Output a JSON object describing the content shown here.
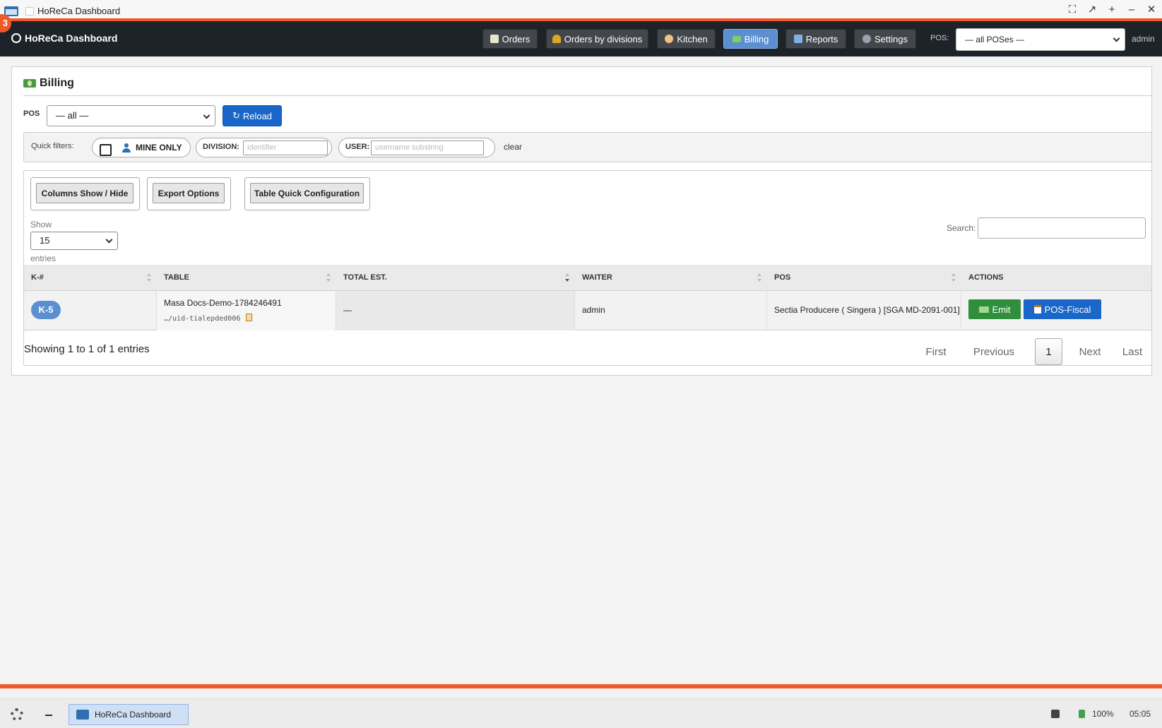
{
  "window": {
    "title": "HoReCa Dashboard",
    "notification_count": "3"
  },
  "navbar": {
    "brand": "HoReCa Dashboard",
    "items": [
      {
        "label": "Orders",
        "icon": "memo-icon",
        "active": false
      },
      {
        "label": "Orders by divisions",
        "icon": "bell-icon",
        "active": false
      },
      {
        "label": "Kitchen",
        "icon": "chef-icon",
        "active": false
      },
      {
        "label": "Billing",
        "icon": "money-icon",
        "active": true
      },
      {
        "label": "Reports",
        "icon": "chart-icon",
        "active": false
      },
      {
        "label": "Settings",
        "icon": "gear-icon",
        "active": false
      }
    ],
    "pos_label": "POS:",
    "pos_selected": "— all POSes —",
    "user": "admin"
  },
  "billing": {
    "title": "Billing",
    "pos_label": "POS",
    "pos_selected": "— all —",
    "reload_label": "Reload",
    "quick_filters": {
      "label": "Quick filters:",
      "mine_only_label": "MINE ONLY",
      "mine_only_checked": false,
      "division_label": "DIVISION:",
      "division_placeholder": "identifier",
      "user_label": "USER:",
      "user_placeholder": "username substring",
      "clear_label": "clear"
    },
    "toolbar": {
      "columns_label": "Columns Show / Hide",
      "export_label": "Export Options",
      "config_label": "Table Quick Configuration"
    },
    "show_label": "Show",
    "page_size": "15",
    "entries_label": "entries",
    "search_label": "Search:",
    "columns": [
      "K-#",
      "TABLE",
      "TOTAL EST.",
      "WAITER",
      "POS",
      "ACTIONS"
    ],
    "rows": [
      {
        "k": "K-5",
        "table_name": "Masa Docs-Demo-1784246491",
        "table_uid": "…/uid-tialepded006",
        "total_est": "—",
        "waiter": "admin",
        "pos": "Sectia Producere ( Singera ) [SGA MD-2091-001]",
        "emit_label": "Emit",
        "fiscal_label": "POS-Fiscal"
      }
    ],
    "info": "Showing 1 to 1 of 1 entries",
    "pagination": {
      "first": "First",
      "previous": "Previous",
      "current": "1",
      "next": "Next",
      "last": "Last"
    }
  },
  "taskbar": {
    "task_label": "HoReCa Dashboard",
    "battery": "100%",
    "time": "05:05"
  },
  "colors": {
    "accent": "#f0582a",
    "navbar": "#1e2329",
    "primary": "#1a66c9",
    "success": "#2f8f3c",
    "active_nav": "#5b8fd0"
  }
}
